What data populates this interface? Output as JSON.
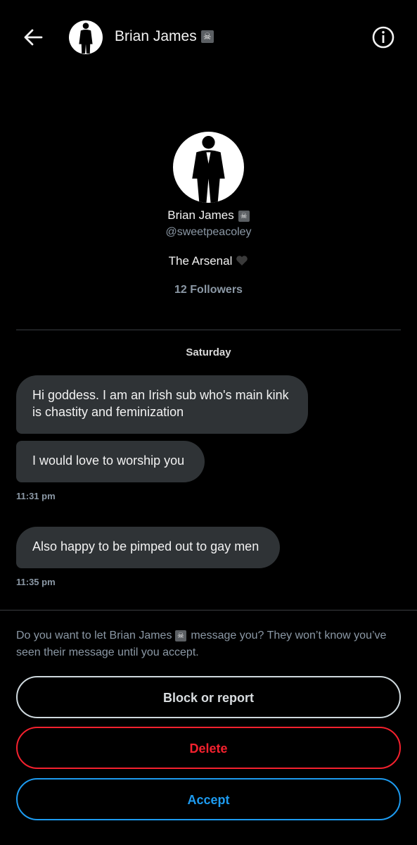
{
  "header": {
    "name": "Brian James",
    "badge": "☠"
  },
  "profile": {
    "name": "Brian James",
    "badge": "☠",
    "handle": "@sweetpeacoley",
    "bio": "The Arsenal",
    "bio_emoji": "black-heart-icon",
    "followers": "12 Followers"
  },
  "conversation": {
    "day_label": "Saturday",
    "messages": [
      {
        "text": "Hi goddess. I am an Irish sub who's main kink is chastity and feminization"
      },
      {
        "text": "I would love to worship you",
        "time": "11:31 pm"
      },
      {
        "text": "Also happy to be pimped out to gay men",
        "time": "11:35 pm"
      }
    ]
  },
  "request": {
    "prompt_before": "Do you want to let Brian James",
    "badge": "☠",
    "prompt_after": "message you? They won’t know you’ve seen their message until you accept.",
    "block_label": "Block or report",
    "delete_label": "Delete",
    "accept_label": "Accept"
  },
  "colors": {
    "background": "#000000",
    "bubble": "#2f3336",
    "secondary_text": "#8b98a5",
    "delete": "#f4212e",
    "accept": "#1d9bf0"
  }
}
